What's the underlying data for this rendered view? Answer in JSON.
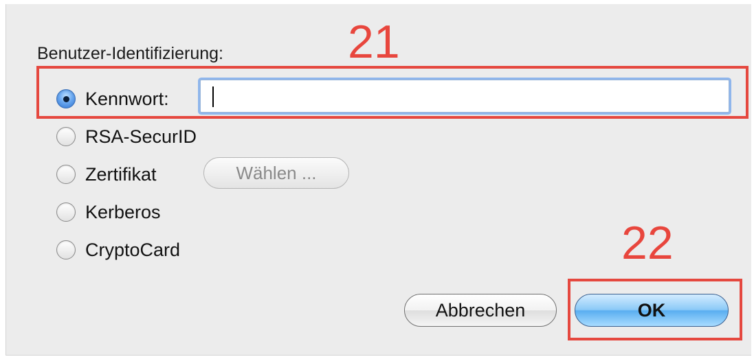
{
  "dialog": {
    "section_label": "Benutzer-Identifizierung:",
    "options": [
      {
        "label": "Kennwort:",
        "selected": true
      },
      {
        "label": "RSA-SecurID",
        "selected": false
      },
      {
        "label": "Zertifikat",
        "selected": false
      },
      {
        "label": "Kerberos",
        "selected": false
      },
      {
        "label": "CryptoCard",
        "selected": false
      }
    ],
    "password_value": "",
    "choose_button_label": "Wählen ...",
    "choose_button_enabled": false,
    "cancel_label": "Abbrechen",
    "ok_label": "OK"
  },
  "annotations": {
    "marker_21": "21",
    "marker_22": "22",
    "color": "#e5483f"
  },
  "colors": {
    "dialog_background": "#ececec",
    "accent_blue": "#5aaef0"
  }
}
